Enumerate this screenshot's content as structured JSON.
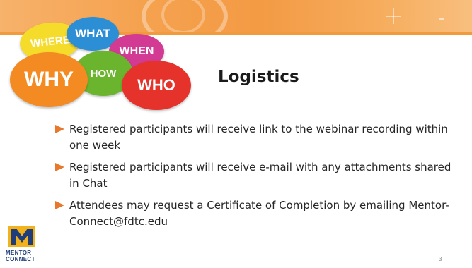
{
  "colors": {
    "banner": "#f39a44",
    "bullet_arrow": "#e8782b",
    "text": "#262626"
  },
  "graphic": {
    "bubbles": [
      {
        "label": "WHERE",
        "color": "#f5dc2b"
      },
      {
        "label": "WHAT",
        "color": "#2c8fd6"
      },
      {
        "label": "WHEN",
        "color": "#d23a93"
      },
      {
        "label": "HOW",
        "color": "#6bb52e"
      },
      {
        "label": "WHY",
        "color": "#f38a22"
      },
      {
        "label": "WHO",
        "color": "#e5322a"
      }
    ]
  },
  "slide": {
    "title": "Logistics",
    "bullets": [
      {
        "text": "Registered participants will receive link to the webinar recording within one week",
        "icon": "arrow-bullet-icon"
      },
      {
        "text": "Registered participants will receive e-mail with any attachments shared in Chat",
        "icon": "arrow-bullet-icon"
      },
      {
        "text": "Attendees may request a Certificate of Completion by emailing Mentor-Connect@fdtc.edu",
        "icon": "arrow-bullet-icon"
      }
    ],
    "page_number": "3"
  },
  "logo": {
    "line1": "MENTOR",
    "line2": "CONNECT"
  }
}
